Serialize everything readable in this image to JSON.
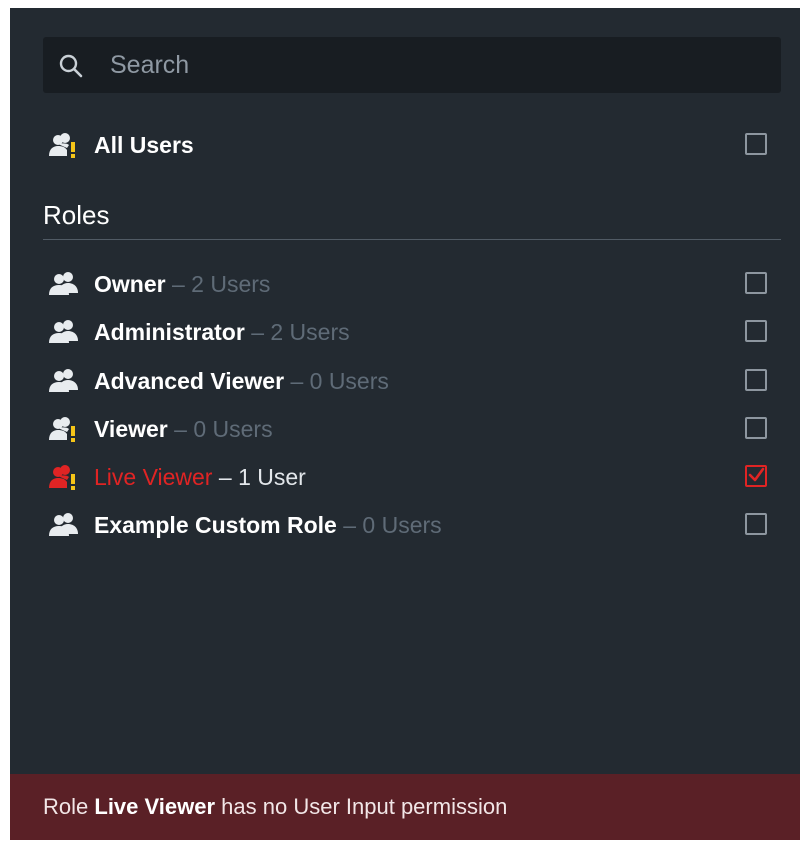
{
  "search": {
    "placeholder": "Search",
    "value": ""
  },
  "all_users": {
    "label": "All Users",
    "checked": false,
    "icon": "users-warning-icon"
  },
  "roles_section": {
    "title": "Roles"
  },
  "roles": [
    {
      "name": "Owner",
      "separator": "–",
      "count": "2 Users",
      "checked": false,
      "icon": "users-icon"
    },
    {
      "name": "Administrator",
      "separator": "–",
      "count": "2 Users",
      "checked": false,
      "icon": "users-icon"
    },
    {
      "name": "Advanced Viewer",
      "separator": "–",
      "count": "0 Users",
      "checked": false,
      "icon": "users-icon"
    },
    {
      "name": "Viewer",
      "separator": "–",
      "count": "0 Users",
      "checked": false,
      "icon": "users-warning-icon"
    },
    {
      "name": "Live Viewer",
      "separator": "–",
      "count": "1 User",
      "checked": true,
      "icon": "users-warning-icon"
    },
    {
      "name": "Example Custom Role",
      "separator": "–",
      "count": "0 Users",
      "checked": false,
      "icon": "users-icon"
    }
  ],
  "warning": {
    "prefix": "Role",
    "role": "Live Viewer",
    "suffix": "has no User Input permission"
  },
  "colors": {
    "panel_bg": "#232a31",
    "accent_red": "#e02424",
    "warning_yellow": "#f5c518",
    "warning_banner": "#5a2026",
    "muted_text": "#5f6b77"
  }
}
